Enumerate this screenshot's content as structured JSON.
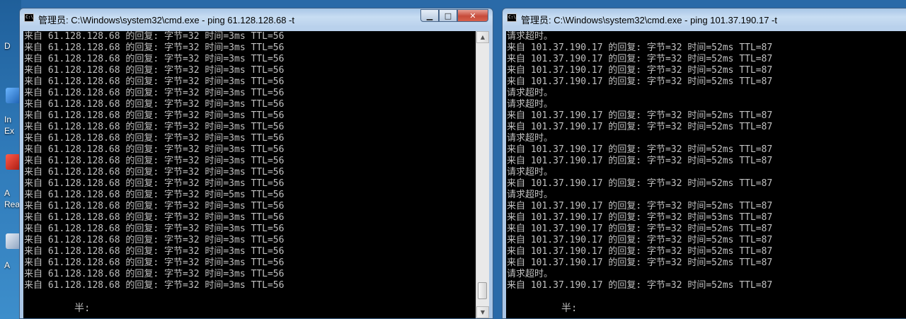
{
  "desktop": {
    "labels": [
      "D",
      "In",
      "Ex",
      "A",
      "Rea",
      "A"
    ]
  },
  "left_window": {
    "title": "管理员: C:\\Windows\\system32\\cmd.exe - ping  61.128.128.68 -t",
    "lines": [
      "来自 61.128.128.68 的回复: 字节=32 时间=3ms TTL=56",
      "来自 61.128.128.68 的回复: 字节=32 时间=3ms TTL=56",
      "来自 61.128.128.68 的回复: 字节=32 时间=3ms TTL=56",
      "来自 61.128.128.68 的回复: 字节=32 时间=3ms TTL=56",
      "来自 61.128.128.68 的回复: 字节=32 时间=3ms TTL=56",
      "来自 61.128.128.68 的回复: 字节=32 时间=3ms TTL=56",
      "来自 61.128.128.68 的回复: 字节=32 时间=3ms TTL=56",
      "来自 61.128.128.68 的回复: 字节=32 时间=3ms TTL=56",
      "来自 61.128.128.68 的回复: 字节=32 时间=3ms TTL=56",
      "来自 61.128.128.68 的回复: 字节=32 时间=3ms TTL=56",
      "来自 61.128.128.68 的回复: 字节=32 时间=3ms TTL=56",
      "来自 61.128.128.68 的回复: 字节=32 时间=3ms TTL=56",
      "来自 61.128.128.68 的回复: 字节=32 时间=3ms TTL=56",
      "来自 61.128.128.68 的回复: 字节=32 时间=3ms TTL=56",
      "来自 61.128.128.68 的回复: 字节=32 时间=5ms TTL=56",
      "来自 61.128.128.68 的回复: 字节=32 时间=3ms TTL=56",
      "来自 61.128.128.68 的回复: 字节=32 时间=3ms TTL=56",
      "来自 61.128.128.68 的回复: 字节=32 时间=3ms TTL=56",
      "来自 61.128.128.68 的回复: 字节=32 时间=3ms TTL=56",
      "来自 61.128.128.68 的回复: 字节=32 时间=3ms TTL=56",
      "来自 61.128.128.68 的回复: 字节=32 时间=3ms TTL=56",
      "来自 61.128.128.68 的回复: 字节=32 时间=3ms TTL=56",
      "来自 61.128.128.68 的回复: 字节=32 时间=3ms TTL=56"
    ],
    "prompt": "半:"
  },
  "right_window": {
    "title": "管理员: C:\\Windows\\system32\\cmd.exe - ping  101.37.190.17 -t",
    "lines": [
      "请求超时。",
      "来自 101.37.190.17 的回复: 字节=32 时间=52ms TTL=87",
      "来自 101.37.190.17 的回复: 字节=32 时间=52ms TTL=87",
      "来自 101.37.190.17 的回复: 字节=32 时间=52ms TTL=87",
      "来自 101.37.190.17 的回复: 字节=32 时间=52ms TTL=87",
      "请求超时。",
      "请求超时。",
      "来自 101.37.190.17 的回复: 字节=32 时间=52ms TTL=87",
      "来自 101.37.190.17 的回复: 字节=32 时间=52ms TTL=87",
      "请求超时。",
      "来自 101.37.190.17 的回复: 字节=32 时间=52ms TTL=87",
      "来自 101.37.190.17 的回复: 字节=32 时间=52ms TTL=87",
      "请求超时。",
      "来自 101.37.190.17 的回复: 字节=32 时间=52ms TTL=87",
      "请求超时。",
      "来自 101.37.190.17 的回复: 字节=32 时间=52ms TTL=87",
      "来自 101.37.190.17 的回复: 字节=32 时间=53ms TTL=87",
      "来自 101.37.190.17 的回复: 字节=32 时间=52ms TTL=87",
      "来自 101.37.190.17 的回复: 字节=32 时间=52ms TTL=87",
      "来自 101.37.190.17 的回复: 字节=32 时间=52ms TTL=87",
      "来自 101.37.190.17 的回复: 字节=32 时间=52ms TTL=87",
      "请求超时。",
      "来自 101.37.190.17 的回复: 字节=32 时间=52ms TTL=87"
    ],
    "prompt": "半:"
  },
  "window_controls": {
    "minimize": "▁",
    "maximize": "□",
    "close": "✕"
  },
  "colors": {
    "console_bg": "#000000",
    "console_fg": "#c0c0c0",
    "close_button": "#c74b3a"
  }
}
